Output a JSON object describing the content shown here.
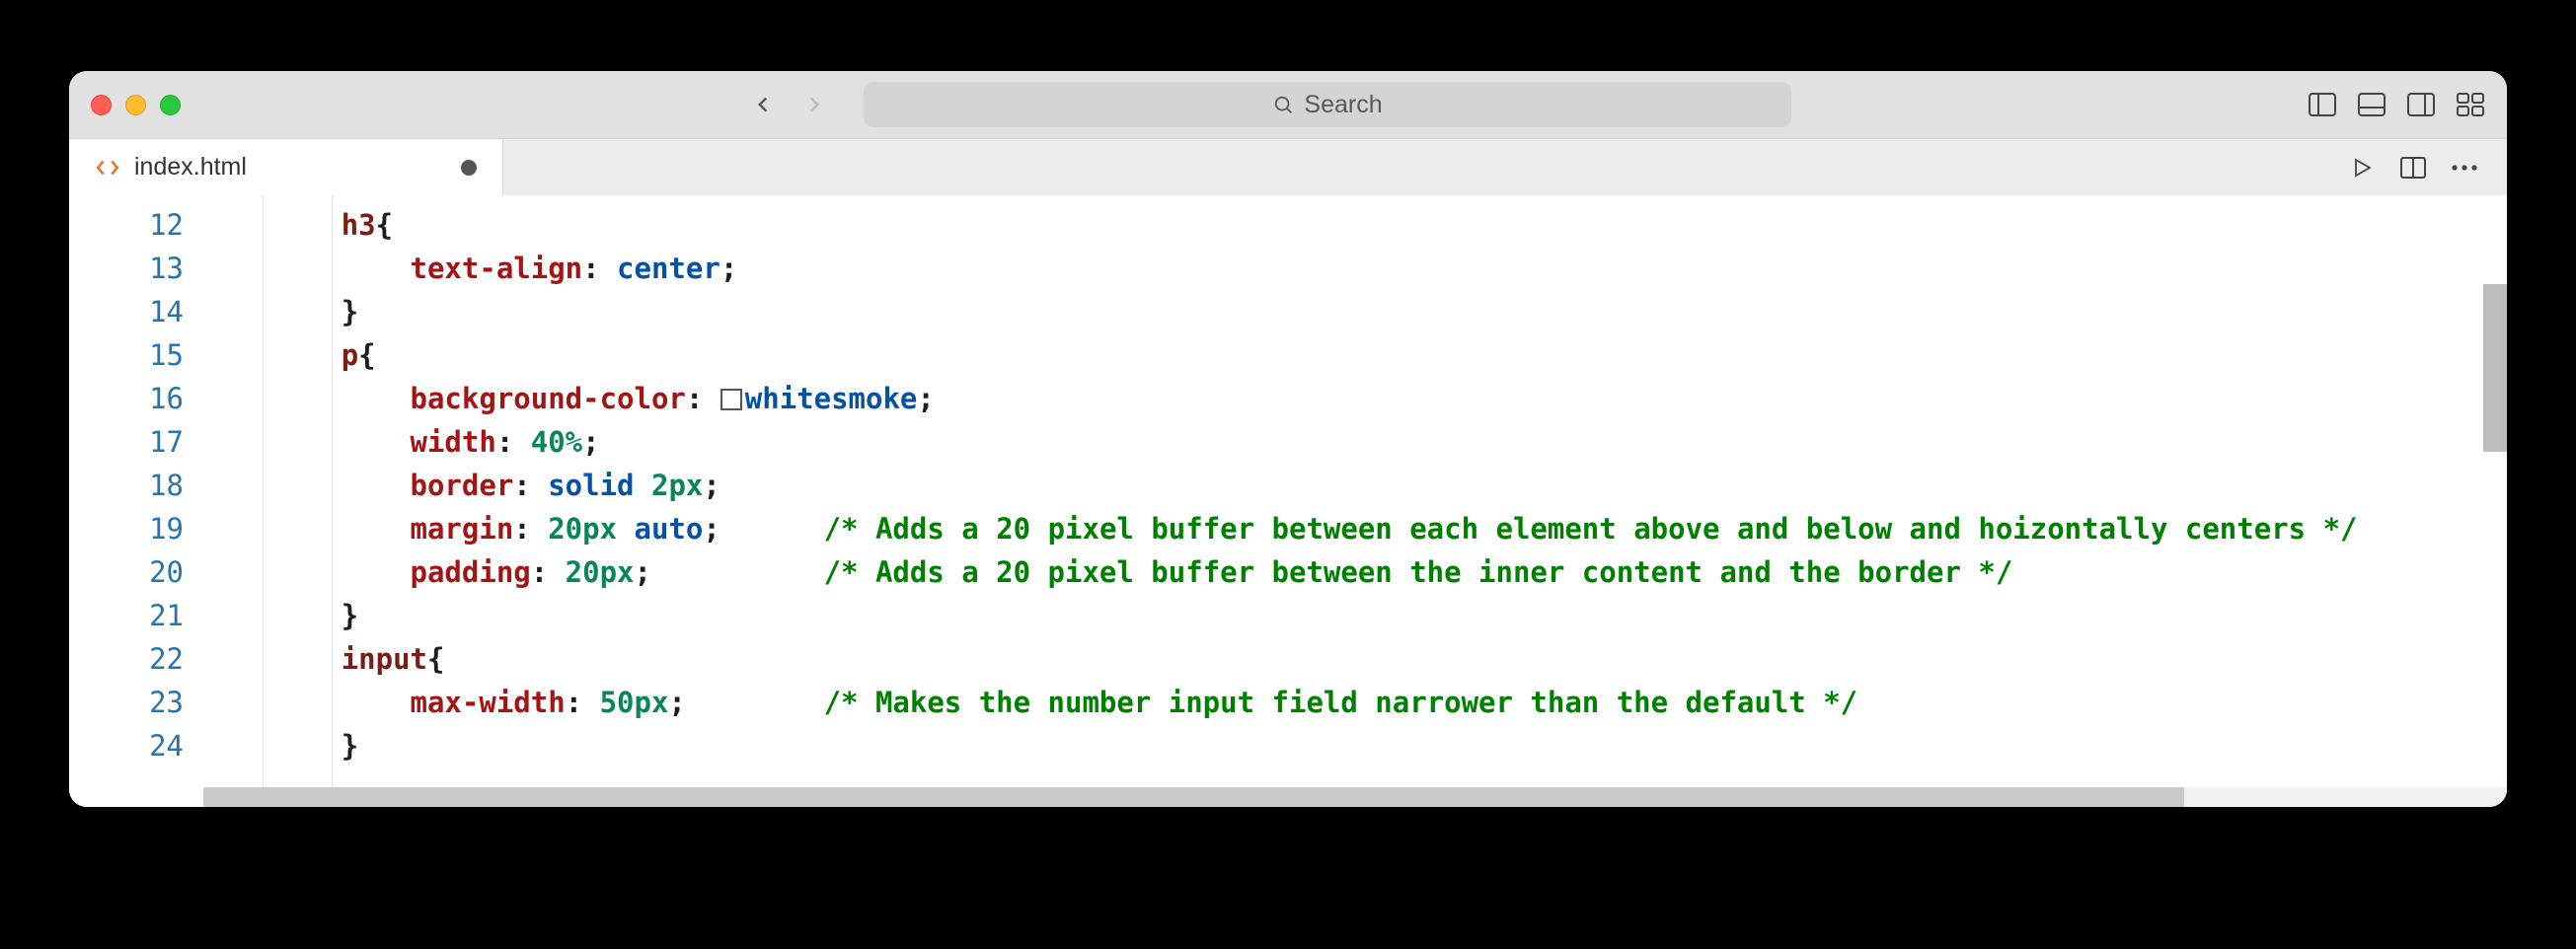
{
  "search": {
    "placeholder": "Search"
  },
  "tab": {
    "filename": "index.html",
    "dirty": true
  },
  "gutter": {
    "start": 12,
    "end": 24
  },
  "code": {
    "lines": [
      {
        "indent": 2,
        "tokens": [
          {
            "t": "h3",
            "c": "sel"
          },
          {
            "t": "{",
            "c": "brace"
          }
        ]
      },
      {
        "indent": 3,
        "tokens": [
          {
            "t": "text-align",
            "c": "prop"
          },
          {
            "t": ": ",
            "c": "punct"
          },
          {
            "t": "center",
            "c": "val"
          },
          {
            "t": ";",
            "c": "punct"
          }
        ]
      },
      {
        "indent": 2,
        "tokens": [
          {
            "t": "}",
            "c": "brace"
          }
        ]
      },
      {
        "indent": 2,
        "tokens": [
          {
            "t": "p",
            "c": "sel"
          },
          {
            "t": "{",
            "c": "brace"
          }
        ]
      },
      {
        "indent": 3,
        "tokens": [
          {
            "t": "background-color",
            "c": "prop"
          },
          {
            "t": ": ",
            "c": "punct"
          },
          {
            "t": "SWATCH",
            "c": "swatch"
          },
          {
            "t": "whitesmoke",
            "c": "val"
          },
          {
            "t": ";",
            "c": "punct"
          }
        ]
      },
      {
        "indent": 3,
        "tokens": [
          {
            "t": "width",
            "c": "prop"
          },
          {
            "t": ": ",
            "c": "punct"
          },
          {
            "t": "40%",
            "c": "num"
          },
          {
            "t": ";",
            "c": "punct"
          }
        ]
      },
      {
        "indent": 3,
        "tokens": [
          {
            "t": "border",
            "c": "prop"
          },
          {
            "t": ": ",
            "c": "punct"
          },
          {
            "t": "solid",
            "c": "val"
          },
          {
            "t": " ",
            "c": "punct"
          },
          {
            "t": "2px",
            "c": "num"
          },
          {
            "t": ";",
            "c": "punct"
          }
        ]
      },
      {
        "indent": 3,
        "tokens": [
          {
            "t": "margin",
            "c": "prop"
          },
          {
            "t": ": ",
            "c": "punct"
          },
          {
            "t": "20px",
            "c": "num"
          },
          {
            "t": " ",
            "c": "punct"
          },
          {
            "t": "auto",
            "c": "val"
          },
          {
            "t": ";",
            "c": "punct"
          }
        ],
        "pad_to": 24,
        "comment": "/* Adds a 20 pixel buffer between each element above and below and hoizontally centers */"
      },
      {
        "indent": 3,
        "tokens": [
          {
            "t": "padding",
            "c": "prop"
          },
          {
            "t": ": ",
            "c": "punct"
          },
          {
            "t": "20px",
            "c": "num"
          },
          {
            "t": ";",
            "c": "punct"
          }
        ],
        "pad_to": 24,
        "comment": "/* Adds a 20 pixel buffer between the inner content and the border */"
      },
      {
        "indent": 2,
        "tokens": [
          {
            "t": "}",
            "c": "brace"
          }
        ]
      },
      {
        "indent": 2,
        "tokens": [
          {
            "t": "input",
            "c": "sel"
          },
          {
            "t": "{",
            "c": "brace"
          }
        ]
      },
      {
        "indent": 3,
        "tokens": [
          {
            "t": "max-width",
            "c": "prop"
          },
          {
            "t": ": ",
            "c": "punct"
          },
          {
            "t": "50px",
            "c": "num"
          },
          {
            "t": ";",
            "c": "punct"
          }
        ],
        "pad_to": 24,
        "comment": "/* Makes the number input field narrower than the default */"
      },
      {
        "indent": 2,
        "tokens": [
          {
            "t": "}",
            "c": "brace"
          }
        ]
      }
    ]
  }
}
